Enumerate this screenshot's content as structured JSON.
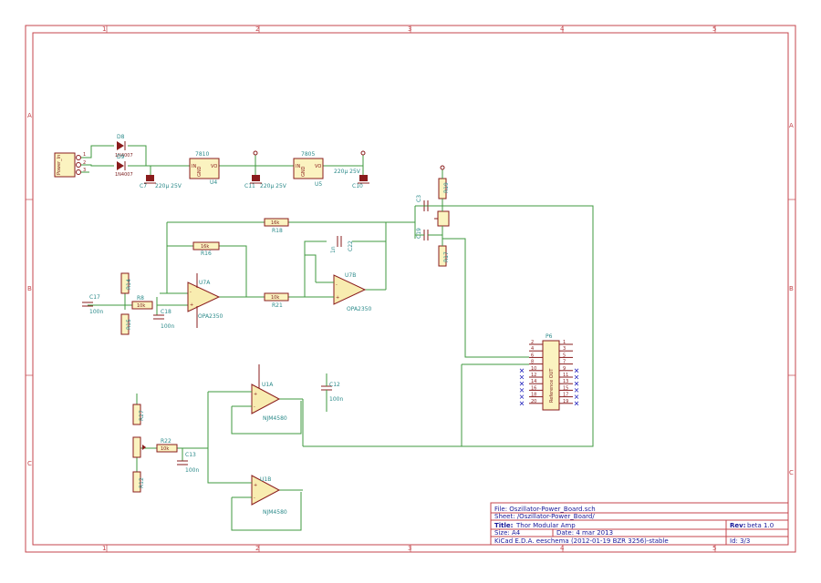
{
  "frame": {
    "cols": [
      "1",
      "2",
      "3",
      "4",
      "5"
    ],
    "rows": [
      "A",
      "B",
      "C"
    ]
  },
  "power_input": {
    "connector_label": "Power_In",
    "d8_ref": "D8",
    "d8_val": "1N4007",
    "d9_ref": "D9",
    "d9_val": "1N4007"
  },
  "regulators": {
    "u4_label": "7810",
    "u4_ref": "U4",
    "u5_label": "7805",
    "u5_ref": "U5",
    "pin_in": "IN",
    "pin_gnd": "GND",
    "pin_out": "VO"
  },
  "capacitors": {
    "c7_ref": "C7",
    "c7_val": "220µ 25V",
    "c11_ref": "C11",
    "c11_val": "220µ 25V",
    "c10_ref": "C10",
    "c10_val": "220µ 25V",
    "c17_ref": "C17",
    "c17_val": "100n",
    "c18_ref": "C18",
    "c18_val": "100n",
    "c12_ref": "C12",
    "c12_val": "100n",
    "c13_ref": "C13",
    "c13_val": "100n",
    "c22_ref": "C22",
    "c22_val": "1n",
    "c3_ref": "C3",
    "c19_ref": "C19"
  },
  "resistors": {
    "r8_val": "10k",
    "r8_ref": "R8",
    "r18_val": "16k",
    "r18_ref": "R18",
    "r16_val": "16k",
    "r16_ref": "R16",
    "r21_val": "10k",
    "r21_ref": "R21",
    "r22_val": "10k",
    "r22_ref": "R22",
    "r14_ref": "R14",
    "r15_ref": "R15",
    "r19_ref": "R19",
    "r17_ref": "R17",
    "r27_ref": "R27",
    "r12_ref": "R12"
  },
  "opamps": {
    "u7a_ref": "U7A",
    "u7a_val": "OPA2350",
    "u7b_ref": "U7B",
    "u7b_val": "OPA2350",
    "u1a_ref": "U1A",
    "u1a_val": "NJM4580",
    "u1b_ref": "U1B",
    "u1b_val": "NJM4580"
  },
  "connector_p6": {
    "ref": "P6",
    "body_label": "Reference OUT",
    "left_pins": [
      "2",
      "4",
      "6",
      "8",
      "10",
      "12",
      "14",
      "16",
      "18",
      "20"
    ],
    "right_pins": [
      "1",
      "3",
      "5",
      "7",
      "9",
      "11",
      "13",
      "15",
      "17",
      "19"
    ]
  },
  "title_block": {
    "file": "File: Oszillator-Power_Board.sch",
    "sheet": "Sheet: /Oszillator-Power_Board/",
    "title_label": "Title:",
    "title": "Thor Modular Amp",
    "size": "Size: A4",
    "date": "Date: 4 mar 2013",
    "rev_label": "Rev:",
    "rev": "beta 1.0",
    "tool": "KiCad E.D.A.  eeschema (2012-01-19 BZR 3256)-stable",
    "id": "Id: 3/3"
  },
  "colors": {
    "frame": "#c4464c",
    "wire": "#3f9a3f",
    "component": "#8a1c1c",
    "reference_text": "#2b8a8a",
    "title_text": "#1a1a9a"
  }
}
